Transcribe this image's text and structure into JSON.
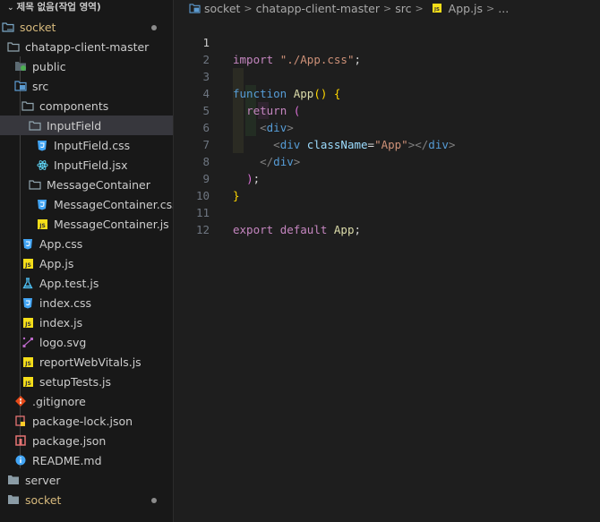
{
  "workspace": {
    "title": "제목 없음(작업 영역)"
  },
  "explorer": {
    "items": [
      {
        "label": "socket",
        "icon": "folder-open-icon",
        "modified": true
      },
      {
        "label": "chatapp-client-master",
        "icon": "folder-open-icon"
      },
      {
        "label": "public",
        "icon": "folder-public-icon"
      },
      {
        "label": "src",
        "icon": "folder-src-icon"
      },
      {
        "label": "components",
        "icon": "folder-open-icon"
      },
      {
        "label": "InputField",
        "icon": "folder-open-icon",
        "selected": true
      },
      {
        "label": "InputField.css",
        "icon": "css-file-icon"
      },
      {
        "label": "InputField.jsx",
        "icon": "react-file-icon"
      },
      {
        "label": "MessageContainer",
        "icon": "folder-open-icon"
      },
      {
        "label": "MessageContainer.css",
        "icon": "css-file-icon"
      },
      {
        "label": "MessageContainer.js",
        "icon": "js-file-icon"
      },
      {
        "label": "App.css",
        "icon": "css-file-icon"
      },
      {
        "label": "App.js",
        "icon": "js-file-icon"
      },
      {
        "label": "App.test.js",
        "icon": "test-file-icon"
      },
      {
        "label": "index.css",
        "icon": "css-file-icon"
      },
      {
        "label": "index.js",
        "icon": "js-file-icon"
      },
      {
        "label": "logo.svg",
        "icon": "svg-file-icon"
      },
      {
        "label": "reportWebVitals.js",
        "icon": "js-file-icon"
      },
      {
        "label": "setupTests.js",
        "icon": "js-file-icon"
      },
      {
        "label": ".gitignore",
        "icon": "git-file-icon"
      },
      {
        "label": "package-lock.json",
        "icon": "lock-json-icon"
      },
      {
        "label": "package.json",
        "icon": "npm-file-icon"
      },
      {
        "label": "README.md",
        "icon": "info-file-icon"
      },
      {
        "label": "server",
        "icon": "folder-closed-icon"
      },
      {
        "label": "socket",
        "icon": "folder-closed-icon",
        "modified": true
      }
    ]
  },
  "breadcrumb": {
    "items": [
      "socket",
      "chatapp-client-master",
      "src",
      "App.js",
      "..."
    ],
    "separator": ">"
  },
  "editor": {
    "active_line": 1,
    "lines": [
      {
        "n": "1",
        "import_kw": "import",
        "path": "\"./App.css\"",
        "semi": ";"
      },
      {
        "n": "2"
      },
      {
        "n": "3",
        "fn_kw": "function",
        "fn_name": "App",
        "parens": "()",
        "brace": "{"
      },
      {
        "n": "4",
        "return_kw": "return",
        "paren": "("
      },
      {
        "n": "5",
        "open": "<",
        "tag": "div",
        "close": ">"
      },
      {
        "n": "6",
        "open": "<",
        "tag": "div",
        "attr": "className",
        "eq": "=",
        "val": "\"App\"",
        "close": ">",
        "end_open": "</",
        "end_tag": "div",
        "end_close": ">"
      },
      {
        "n": "7",
        "end_open": "</",
        "tag": "div",
        "close": ">"
      },
      {
        "n": "8",
        "paren": ")",
        "semi": ";"
      },
      {
        "n": "9",
        "brace": "}"
      },
      {
        "n": "10"
      },
      {
        "n": "11",
        "export_kw": "export",
        "default_kw": "default",
        "name": "App",
        "semi": ";"
      },
      {
        "n": "12"
      }
    ]
  },
  "colors": {
    "keyword": "#c586c0",
    "storage": "#569cd6",
    "string": "#ce9178",
    "function": "#dcdcaa",
    "bracket1": "#ffd700",
    "bracket2": "#da70d6"
  }
}
